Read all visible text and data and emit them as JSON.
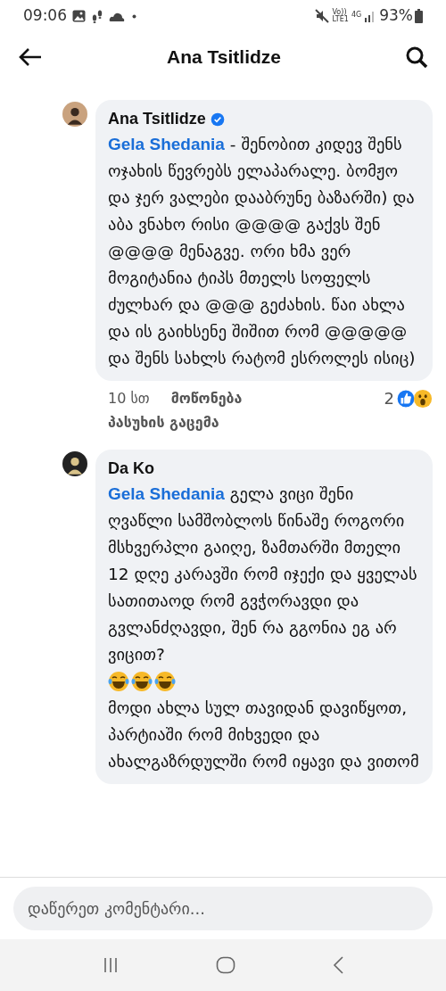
{
  "status_bar": {
    "time": "09:06",
    "volte": "Vo))",
    "lte": "LTE1",
    "network": "4G",
    "battery": "93%"
  },
  "header": {
    "title": "Ana Tsitlidze"
  },
  "comments": [
    {
      "author": "Ana Tsitlidze",
      "verified": true,
      "mention": "Gela Shedania",
      "text": "- შენობით კიდევ შენს ოჯახის წევრებს ელაპარალე. ბომჟო და ჯერ ვალები დააბრუნე ბაზარში) და აბა ვნახო რისი @@@@ გაქვს შენ @@@@ მენაგვე. ორი ხმა ვერ მოგიტანია ტიპს მთელს სოფელს ძულხარ და @@@ გეძახის. წაი ახლა და ის გაიხსენე შიშით რომ @@@@@ და შენს სახლს რატომ ესროლეს ისიც)",
      "time": "10 სთ",
      "like_label": "მოწონება",
      "reply_label": "პასუხის გაცემა",
      "reaction_count": "2",
      "reactions": [
        {
          "kind": "like"
        },
        {
          "kind": "wow"
        }
      ]
    },
    {
      "author": "Da Ko",
      "verified": false,
      "mention": "Gela Shedania",
      "text": "გელა ვიცი შენი ღვაწლი სამშობლოს წინაშე როგორი მსხვერპლი გაიღე, ზამთარში მთელი 12 დღე კარავში რომ იჯექი და ყველას სათითაოდ რომ გვჭორავდი და გვლანძღავდი, შენ რა გგონია ეგ არ ვიცით?",
      "emojis": [
        {
          "kind": "laugh"
        },
        {
          "kind": "laugh"
        },
        {
          "kind": "laugh"
        }
      ],
      "text_2": "მოდი ახლა სულ თავიდან დავიწყოთ, პარტიაში რომ მიხვედი და ახალგაზრდულში რომ იყავი და ვითომ"
    }
  ],
  "composer": {
    "placeholder": "დაწერეთ კომენტარი..."
  }
}
